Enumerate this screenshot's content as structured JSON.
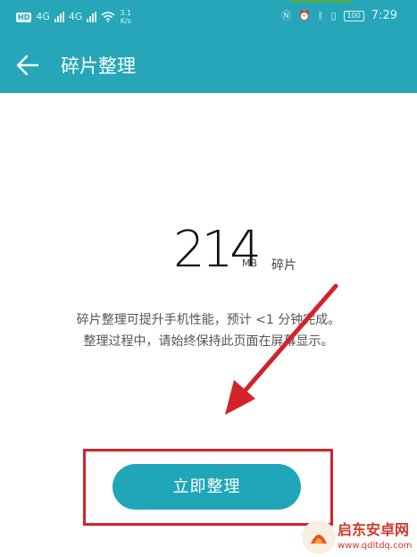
{
  "status_bar": {
    "network_1": "4G",
    "network_2": "4G",
    "speed_value": "3.1",
    "speed_unit": "K/s",
    "battery": "100",
    "time": "7:29",
    "icons": [
      "hd-icon",
      "signal-icon",
      "wifi-icon",
      "nfc-icon",
      "alarm-icon",
      "bluetooth-icon",
      "vibrate-icon",
      "battery-icon"
    ]
  },
  "app_bar": {
    "title": "碎片整理",
    "back_icon": "back-arrow-icon"
  },
  "summary": {
    "size": "214",
    "unit": "MB",
    "label": "碎片"
  },
  "description": {
    "line1": "碎片整理可提升手机性能，预计 <1 分钟完成。",
    "line2": "整理过程中，请始终保持此页面在屏幕显示。"
  },
  "action": {
    "button_label": "立即整理"
  },
  "watermark": {
    "title": "启东安卓网",
    "url": "www.qdltdq.com"
  },
  "colors": {
    "accent": "#26a6b8",
    "button": "#1fa6b8",
    "annotation": "#d2232a"
  }
}
